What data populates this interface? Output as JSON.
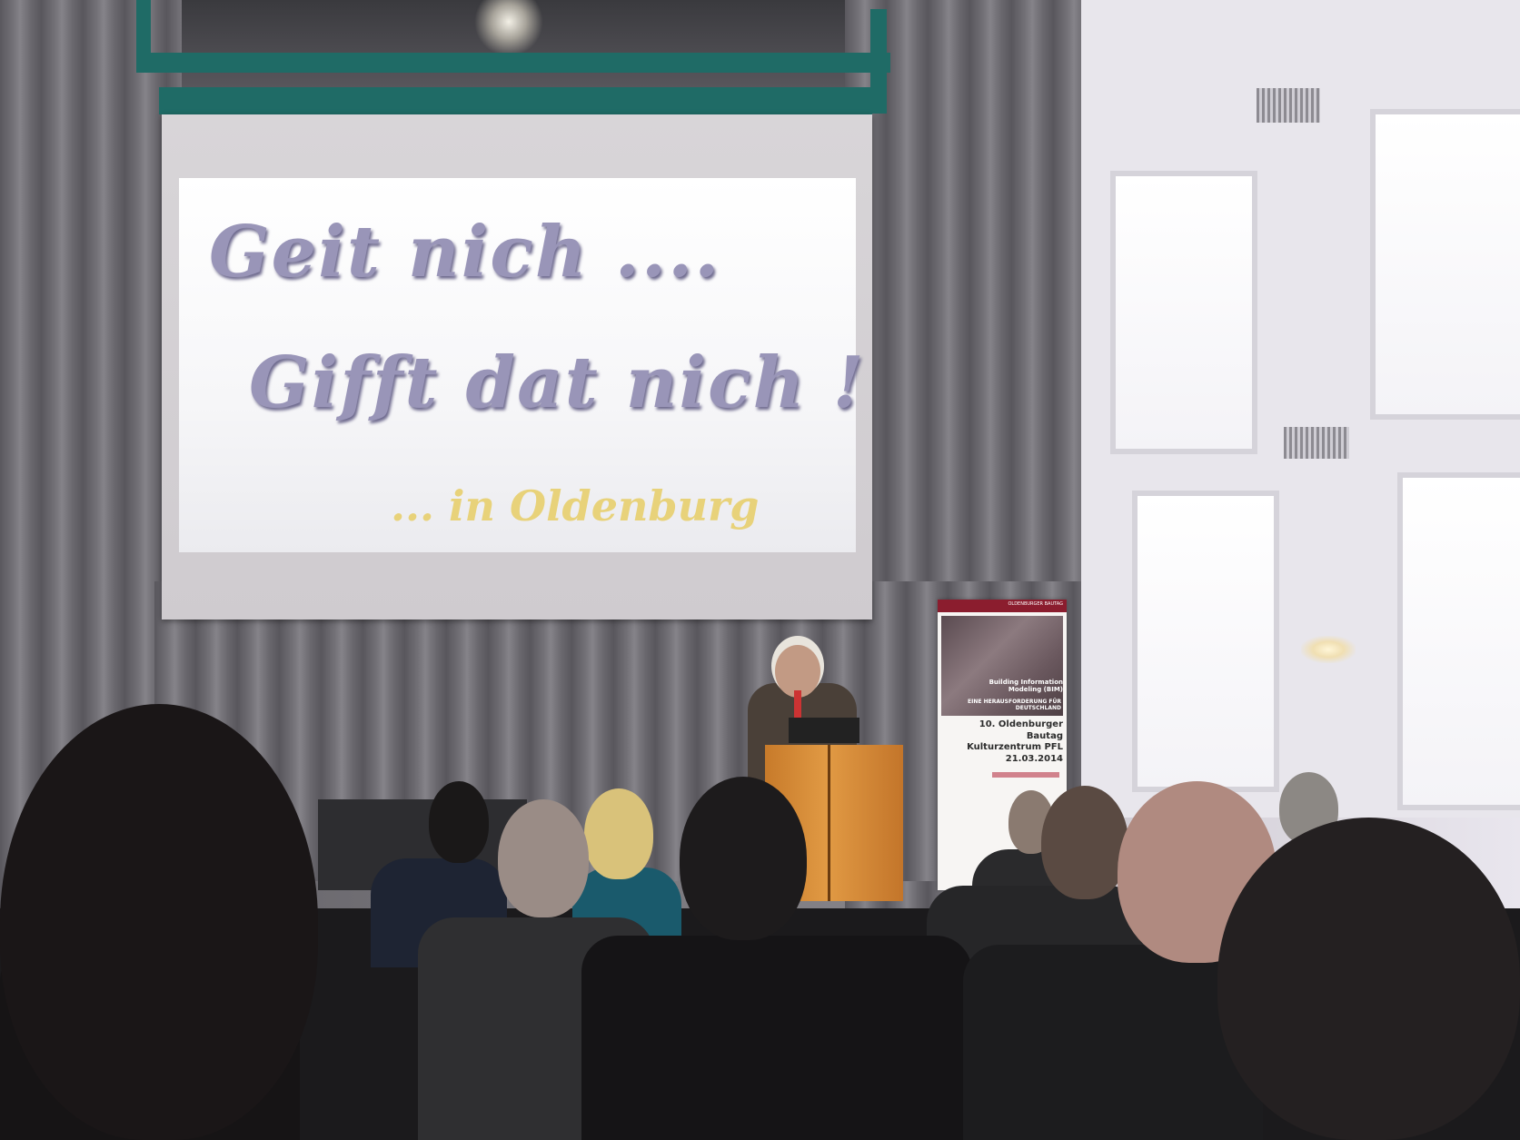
{
  "slide": {
    "line1": "Geit nich ....",
    "line2": "Gifft dat nich !",
    "line3": "... in Oldenburg"
  },
  "banner": {
    "header": "OLDENBURGER BAUTAG",
    "subtitle": "Building Information Modeling (BIM)",
    "claim": "EINE HERAUSFORDERUNG FÜR DEUTSCHLAND",
    "title": "10. Oldenburger Bautag",
    "venue": "Kulturzentrum PFL",
    "date": "21.03.2014"
  }
}
